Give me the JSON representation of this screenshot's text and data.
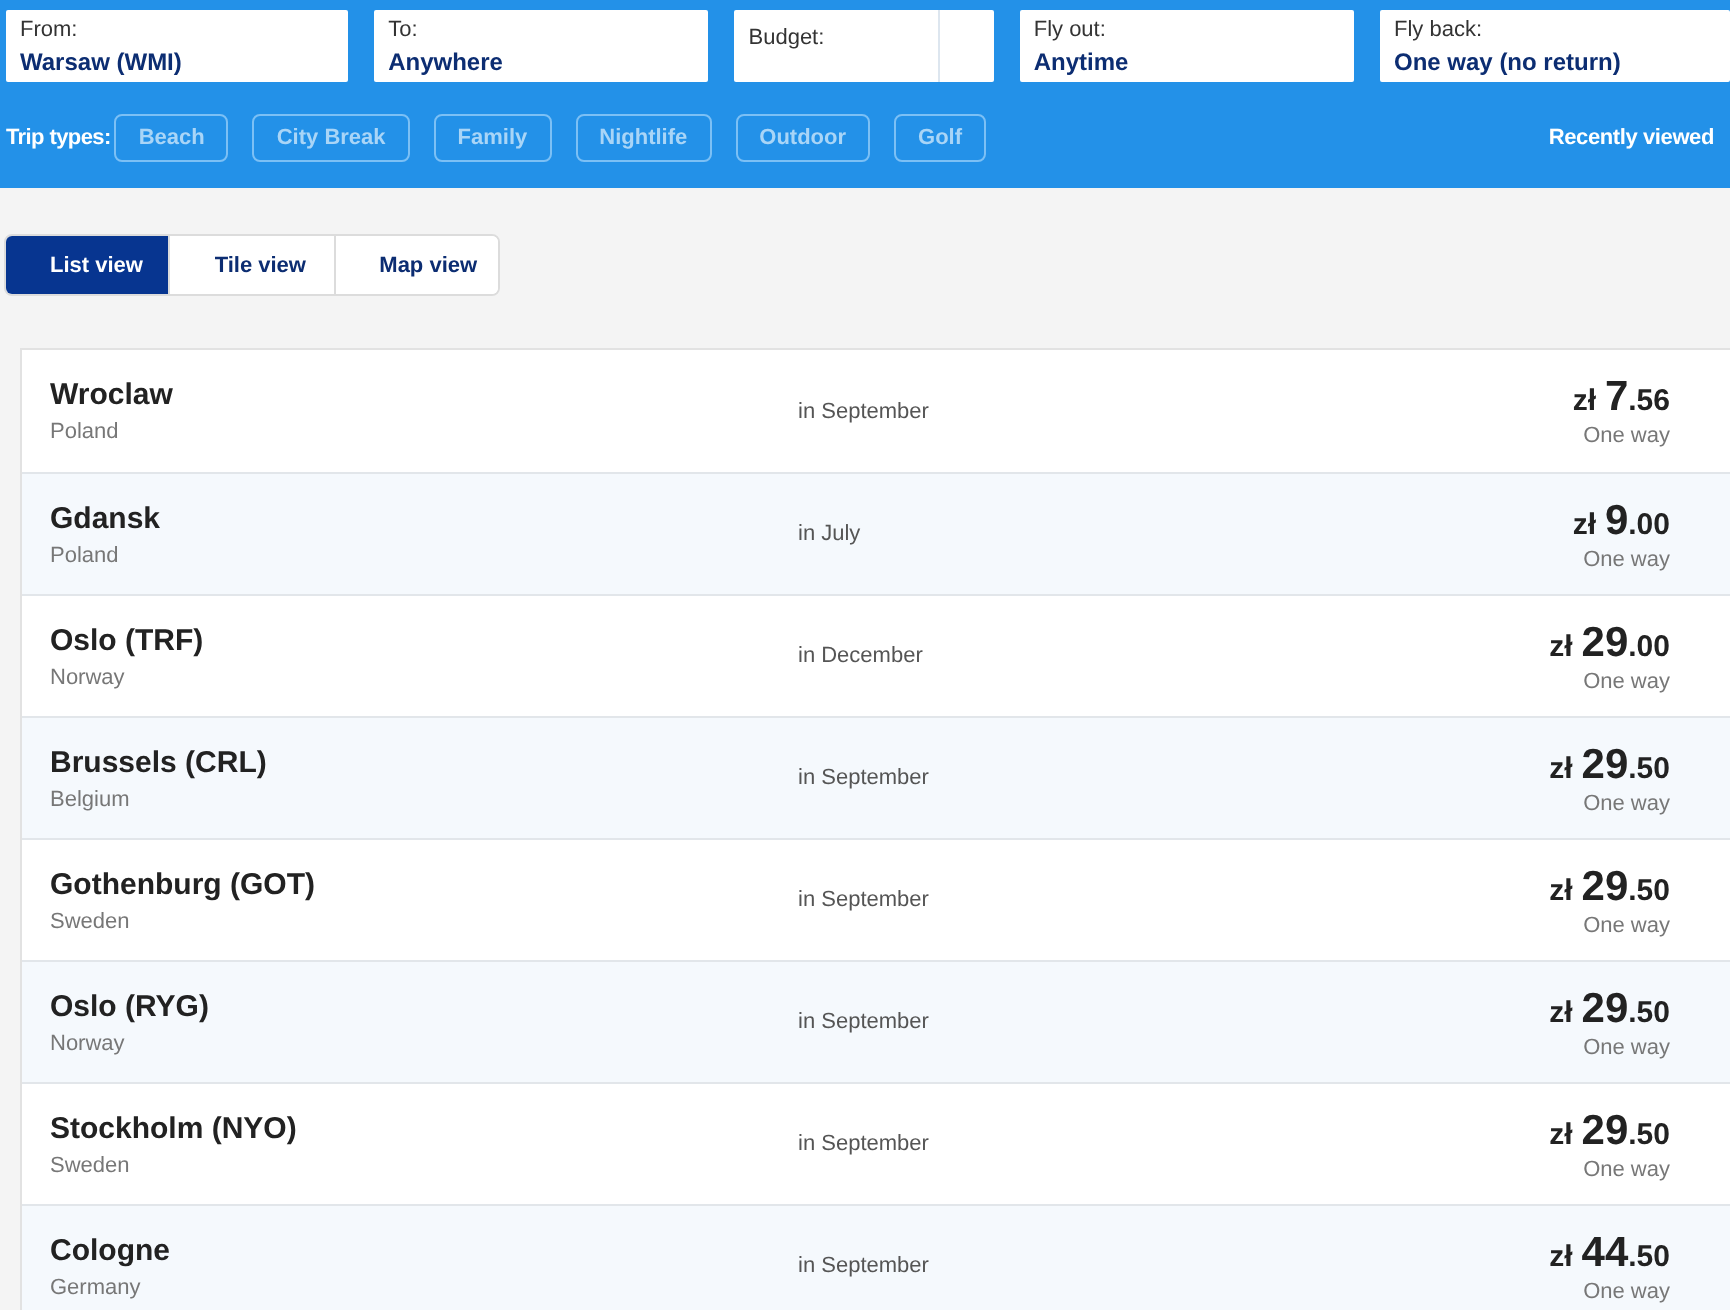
{
  "search_fields": [
    {
      "label": "From:",
      "value": "Warsaw (WMI)",
      "kind": "text"
    },
    {
      "label": "To:",
      "value": "Anywhere",
      "kind": "text"
    },
    {
      "label": "Budget:",
      "kind": "budget"
    },
    {
      "label": "Fly out:",
      "value": "Anytime",
      "kind": "text"
    },
    {
      "label": "Fly back:",
      "value": "One way (no return)",
      "kind": "text"
    }
  ],
  "trip_types": {
    "label": "Trip types:",
    "options": [
      {
        "label": "Beach",
        "selected": false
      },
      {
        "label": "City Break",
        "selected": false
      },
      {
        "label": "Family",
        "selected": false
      },
      {
        "label": "Nightlife",
        "selected": false
      },
      {
        "label": "Outdoor",
        "selected": false
      },
      {
        "label": "Golf",
        "selected": false
      }
    ]
  },
  "recently_viewed": "Recently viewed",
  "view_tabs": [
    {
      "label": "List view",
      "selected": true
    },
    {
      "label": "Tile view",
      "selected": false
    },
    {
      "label": "Map view",
      "selected": false
    }
  ],
  "destinations": [
    {
      "city": "Wroclaw",
      "country": "Poland",
      "month": "in September",
      "currency": "zł",
      "whole": "7",
      "fraction": ".56",
      "trip": "One way"
    },
    {
      "city": "Gdansk",
      "country": "Poland",
      "month": "in July",
      "currency": "zł",
      "whole": "9",
      "fraction": ".00",
      "trip": "One way"
    },
    {
      "city": "Oslo (TRF)",
      "country": "Norway",
      "month": "in December",
      "currency": "zł",
      "whole": "29",
      "fraction": ".00",
      "trip": "One way"
    },
    {
      "city": "Brussels (CRL)",
      "country": "Belgium",
      "month": "in September",
      "currency": "zł",
      "whole": "29",
      "fraction": ".50",
      "trip": "One way"
    },
    {
      "city": "Gothenburg (GOT)",
      "country": "Sweden",
      "month": "in September",
      "currency": "zł",
      "whole": "29",
      "fraction": ".50",
      "trip": "One way"
    },
    {
      "city": "Oslo (RYG)",
      "country": "Norway",
      "month": "in September",
      "currency": "zł",
      "whole": "29",
      "fraction": ".50",
      "trip": "One way"
    },
    {
      "city": "Stockholm (NYO)",
      "country": "Sweden",
      "month": "in September",
      "currency": "zł",
      "whole": "29",
      "fraction": ".50",
      "trip": "One way"
    },
    {
      "city": "Cologne",
      "country": "Germany",
      "month": "in September",
      "currency": "zł",
      "whole": "44",
      "fraction": ".50",
      "trip": "One way"
    }
  ]
}
